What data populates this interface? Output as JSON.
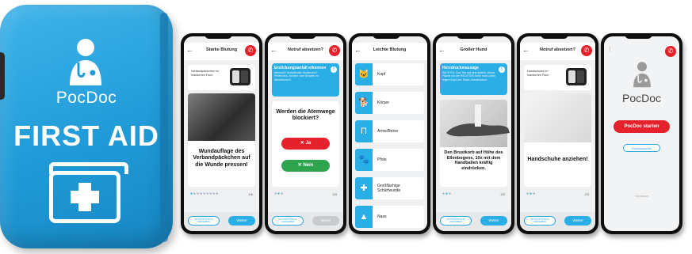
{
  "case": {
    "brand": "PocDoc",
    "label": "FIRST AID"
  },
  "phones": [
    {
      "title": "Starke Blutung",
      "info_text": "Verbandpäckchen im markierten Fach",
      "main_text": "Wundauflage des Verbandpäckchen auf die Wunde pressen!",
      "pager": "1/6",
      "secondary_button": "NOTRUF/STEUN VERGEBEN",
      "next_button": "Weiter"
    },
    {
      "title": "Notruf absetzen?",
      "alert_title": "Erstickungsanfall erkennen",
      "alert_text": "Atemnot? Anhaltender Hustenreiz? Pfeifendes, Ächzen oder Brodeln im Atembereich?",
      "question": "Werden die Atemwege blockiert?",
      "yes": "Ja",
      "no": "Nein",
      "pager": "2/3",
      "secondary_button": "NOTRUF/STEUN VERGEBEN",
      "next_button": "Weiter"
    },
    {
      "title": "Leichte Blutung",
      "items": [
        {
          "label": "Kopf",
          "icon": "cat-head-icon"
        },
        {
          "label": "Körper",
          "icon": "dog-body-icon"
        },
        {
          "label": "Arme/Beine",
          "icon": "legs-icon"
        },
        {
          "label": "Pfote",
          "icon": "paw-icon"
        },
        {
          "label": "Großflächige Schürfwunde",
          "icon": "bandage-icon"
        },
        {
          "label": "Nase",
          "icon": "nose-icon"
        }
      ]
    },
    {
      "title": "Großer Hund",
      "alert_title": "Herzdruckmassage",
      "alert_text": "WICHTIG: Das Tier auf eine stabile, ebene Fläche mit der RECHTEN Seite nach unten legen! Kopf des Tieres überstrecken.",
      "main_text": "Den Brustkorb auf Höhe des Ellenbogens, 10x mit dem Handballen kräftig eindrücken.",
      "pager": "2/3",
      "secondary_button": "NOTRUF/STEUN VERGEBEN",
      "next_button": "Weiter"
    },
    {
      "title": "Notruf absetzen?",
      "info_text": "Handschuhe im markierten Fach",
      "main_text": "Handschuhe anziehen!",
      "pager": "2/3",
      "secondary_button": "NOTRUF/STEUN VERGEBEN",
      "next_button": "Weiter"
    },
    {
      "app_name": "PocDoc",
      "start_button": "PocDoc starten",
      "direct_button": "Direktauswahl",
      "imprint": "Impressum"
    }
  ],
  "colors": {
    "accent": "#2aaee5",
    "emergency": "#e5212b",
    "success": "#2ea44f",
    "case_blue": "#209bd8"
  }
}
